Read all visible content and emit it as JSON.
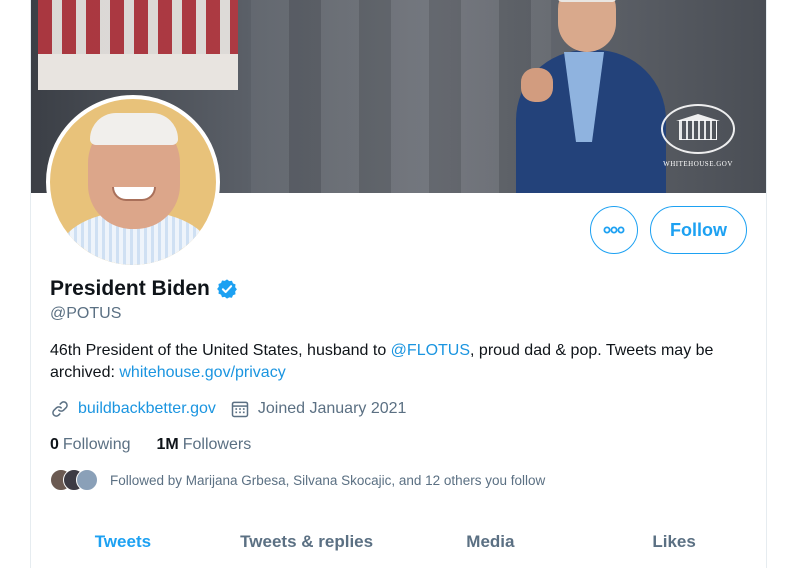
{
  "profile": {
    "display_name": "President Biden",
    "handle": "@POTUS",
    "bio": {
      "part1": "46th President of the United States, husband to ",
      "mention": "@FLOTUS",
      "part2": ", proud dad & pop. Tweets may be archived: ",
      "link": "whitehouse.gov/privacy"
    },
    "website": "buildbackbetter.gov",
    "joined": "Joined January 2021",
    "following_count": "0",
    "following_label": "Following",
    "followers_count": "1M",
    "followers_label": "Followers",
    "followed_by": "Followed by Marijana Grbesa, Silvana Skocajic, and 12 others you follow"
  },
  "banner": {
    "logo_text": "WHITEHOUSE.GOV"
  },
  "actions": {
    "follow_label": "Follow",
    "more_icon": "more-horizontal-icon"
  },
  "tabs": [
    {
      "label": "Tweets",
      "active": true
    },
    {
      "label": "Tweets & replies",
      "active": false
    },
    {
      "label": "Media",
      "active": false
    },
    {
      "label": "Likes",
      "active": false
    }
  ],
  "colors": {
    "accent": "#1da1f2",
    "link": "#1b95e0",
    "secondary_text": "#5b7083",
    "primary_text": "#0f1419"
  }
}
